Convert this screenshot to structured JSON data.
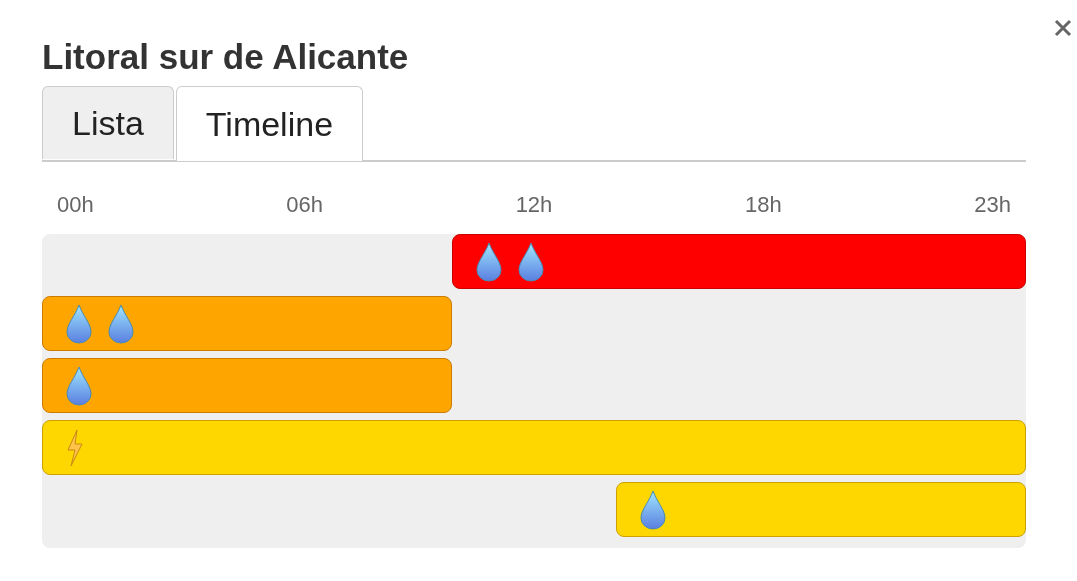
{
  "title": "Litoral sur de Alicante",
  "tabs": [
    {
      "label": "Lista",
      "selected": false
    },
    {
      "label": "Timeline",
      "selected": true
    }
  ],
  "timeline": {
    "ticks": [
      "00h",
      "06h",
      "12h",
      "18h",
      "23h"
    ],
    "bars": [
      {
        "kind": "trailing",
        "level": 0.583,
        "color": "#ff0000",
        "icons": [
          {
            "kind": "rain"
          },
          {
            "kind": "rain"
          }
        ]
      },
      {
        "kind": "leading",
        "level": 0.417,
        "color": "#ffa500",
        "icons": [
          {
            "kind": "rain"
          },
          {
            "kind": "rain"
          }
        ]
      },
      {
        "kind": "leading",
        "level": 0.417,
        "color": "#ffa500",
        "icons": [
          {
            "kind": "rain"
          }
        ]
      },
      {
        "kind": "leading",
        "level": 1,
        "color": "#ffd700",
        "icons": [
          {
            "kind": "storm"
          }
        ]
      },
      {
        "kind": "trailing",
        "level": 0.417,
        "color": "#ffd700",
        "icons": [
          {
            "kind": "rain"
          }
        ]
      }
    ]
  }
}
